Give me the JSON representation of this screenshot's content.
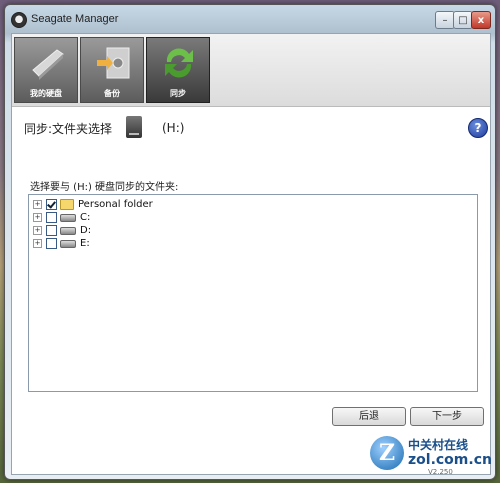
{
  "window": {
    "title": "Seagate Manager",
    "controls": {
      "minimize": "–",
      "maximize": "□",
      "close": "x"
    }
  },
  "toolbar": {
    "buttons": [
      {
        "label": "我的硬盘",
        "icon": "hard-drive-icon",
        "active": false
      },
      {
        "label": "备份",
        "icon": "safe-backup-icon",
        "active": false
      },
      {
        "label": "同步",
        "icon": "sync-arrows-icon",
        "active": true
      }
    ]
  },
  "page": {
    "heading": "同步:文件夹选择",
    "drive_letter": "(H:)",
    "help": "?",
    "prompt": "选择要与 (H:) 硬盘同步的文件夹:"
  },
  "tree": {
    "items": [
      {
        "label": "Personal folder",
        "checked": true,
        "type": "folder"
      },
      {
        "label": "C:",
        "checked": false,
        "type": "drive"
      },
      {
        "label": "D:",
        "checked": false,
        "type": "drive"
      },
      {
        "label": "E:",
        "checked": false,
        "type": "drive"
      }
    ],
    "expander": "+"
  },
  "buttons": {
    "back": "后退",
    "next": "下一步"
  },
  "watermark": {
    "logo_letter": "Z",
    "cn_name": "中关村在线",
    "domain": "zol.com.cn",
    "version": "V2.250"
  }
}
